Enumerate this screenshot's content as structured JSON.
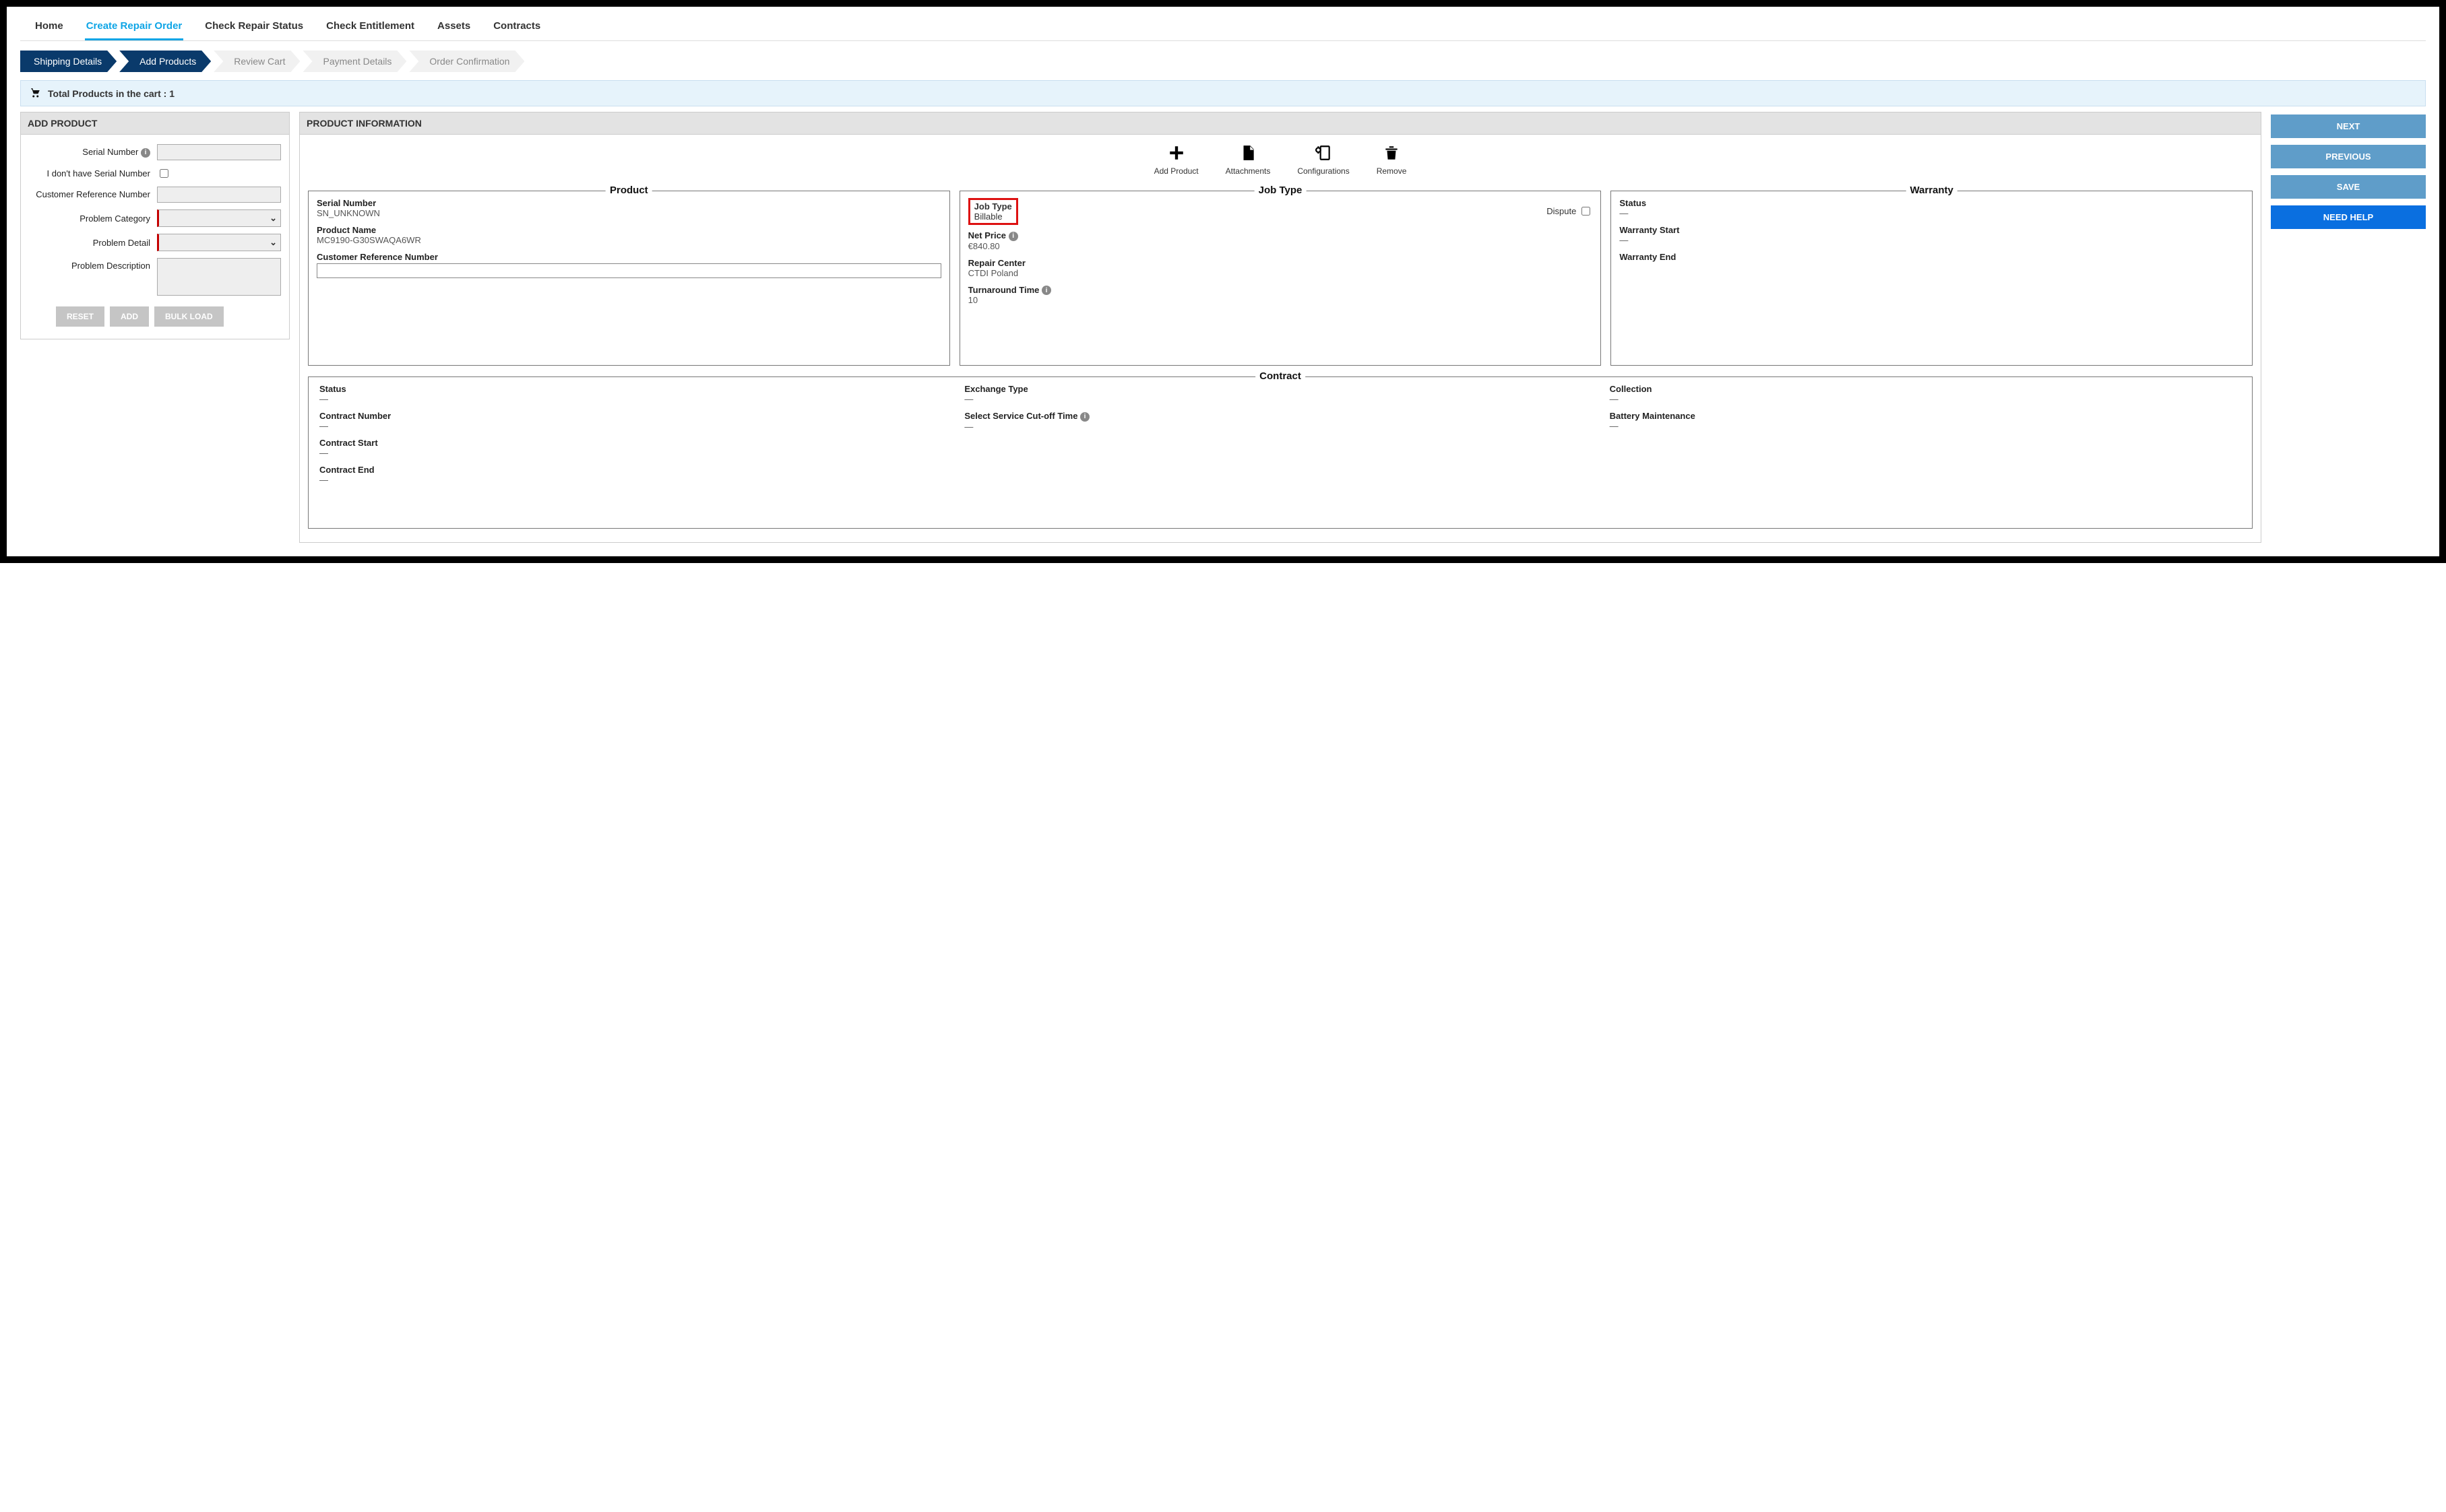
{
  "nav": {
    "home": "Home",
    "create_repair_order": "Create Repair Order",
    "check_repair_status": "Check Repair Status",
    "check_entitlement": "Check Entitlement",
    "assets": "Assets",
    "contracts": "Contracts"
  },
  "steps": {
    "shipping": "Shipping Details",
    "add_products": "Add Products",
    "review_cart": "Review Cart",
    "payment": "Payment Details",
    "confirmation": "Order Confirmation"
  },
  "cart": {
    "label": "Total Products in the cart : 1"
  },
  "add_product_panel": {
    "title": "ADD PRODUCT",
    "serial_number_label": "Serial Number",
    "no_serial_label": "I don't have Serial Number",
    "crn_label": "Customer Reference Number",
    "problem_category_label": "Problem Category",
    "problem_detail_label": "Problem Detail",
    "problem_description_label": "Problem Description",
    "reset": "RESET",
    "add": "ADD",
    "bulk_load": "BULK LOAD"
  },
  "product_info_panel": {
    "title": "PRODUCT INFORMATION",
    "actions": {
      "add_product": "Add Product",
      "attachments": "Attachments",
      "configurations": "Configurations",
      "remove": "Remove"
    },
    "product": {
      "legend": "Product",
      "serial_number_label": "Serial Number",
      "serial_number_value": "SN_UNKNOWN",
      "product_name_label": "Product Name",
      "product_name_value": "MC9190-G30SWAQA6WR",
      "crn_label": "Customer Reference Number"
    },
    "job_type": {
      "legend": "Job Type",
      "job_type_label": "Job Type",
      "job_type_value": "Billable",
      "dispute_label": "Dispute",
      "net_price_label": "Net Price",
      "net_price_value": "€840.80",
      "repair_center_label": "Repair Center",
      "repair_center_value": "CTDI Poland",
      "turnaround_label": "Turnaround Time",
      "turnaround_value": "10"
    },
    "warranty": {
      "legend": "Warranty",
      "status_label": "Status",
      "status_value": "—",
      "start_label": "Warranty Start",
      "start_value": "—",
      "end_label": "Warranty End",
      "end_value": ""
    },
    "contract": {
      "legend": "Contract",
      "status_label": "Status",
      "status_value": "—",
      "exchange_label": "Exchange Type",
      "exchange_value": "—",
      "collection_label": "Collection",
      "collection_value": "—",
      "number_label": "Contract Number",
      "number_value": "—",
      "cutoff_label": "Select Service Cut-off Time",
      "cutoff_value": "—",
      "battery_label": "Battery Maintenance",
      "battery_value": "—",
      "start_label": "Contract Start",
      "start_value": "—",
      "end_label": "Contract End",
      "end_value": "—"
    }
  },
  "side": {
    "next": "NEXT",
    "previous": "PREVIOUS",
    "save": "SAVE",
    "help": "NEED HELP"
  }
}
